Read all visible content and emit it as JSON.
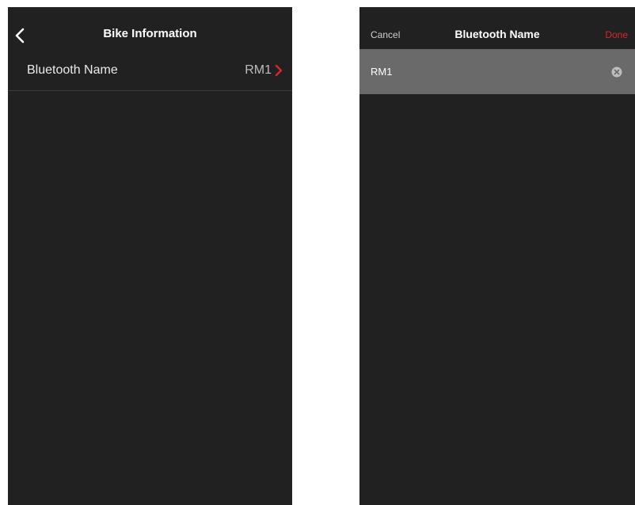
{
  "left_screen": {
    "title": "Bike Information",
    "back_icon": "chevron-left-icon",
    "row": {
      "label": "Bluetooth Name",
      "value": "RM1",
      "icon": "chevron-right-icon"
    }
  },
  "right_screen": {
    "title": "Bluetooth Name",
    "cancel_label": "Cancel",
    "done_label": "Done",
    "input_value": "RM1",
    "clear_icon": "clear-circle-icon"
  },
  "colors": {
    "background": "#212121",
    "accent": "#d8272d",
    "input_bar": "#6a6a6a"
  }
}
